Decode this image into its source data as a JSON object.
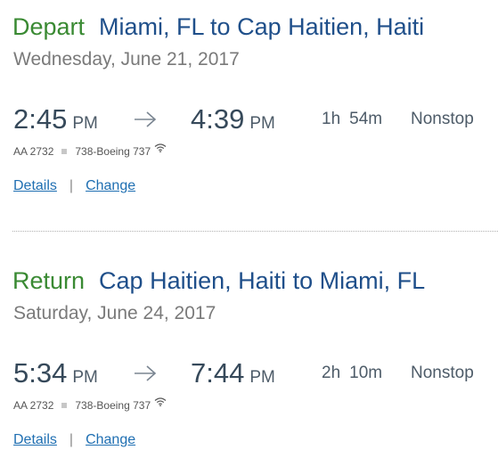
{
  "depart": {
    "direction": "Depart",
    "route": "Miami, FL to Cap Haitien, Haiti",
    "date": "Wednesday, June 21, 2017",
    "dep_time": "2:45",
    "dep_ampm": "PM",
    "arr_time": "4:39",
    "arr_ampm": "PM",
    "duration_h": "1h",
    "duration_m": "54m",
    "stops": "Nonstop",
    "flight_number": "AA 2732",
    "aircraft": "738-Boeing 737",
    "wifi_icon": "wifi-icon",
    "details_label": "Details",
    "separator": "|",
    "change_label": "Change"
  },
  "return": {
    "direction": "Return",
    "route": "Cap Haitien, Haiti to Miami, FL",
    "date": "Saturday, June 24, 2017",
    "dep_time": "5:34",
    "dep_ampm": "PM",
    "arr_time": "7:44",
    "arr_ampm": "PM",
    "duration_h": "2h",
    "duration_m": "10m",
    "stops": "Nonstop",
    "flight_number": "AA 2732",
    "aircraft": "738-Boeing 737",
    "wifi_icon": "wifi-icon",
    "details_label": "Details",
    "separator": "|",
    "change_label": "Change"
  },
  "colors": {
    "direction_green": "#3a8a33",
    "route_blue": "#1f4f8a",
    "link_blue": "#1f6fb2",
    "date_gray": "#7a7a7a"
  }
}
